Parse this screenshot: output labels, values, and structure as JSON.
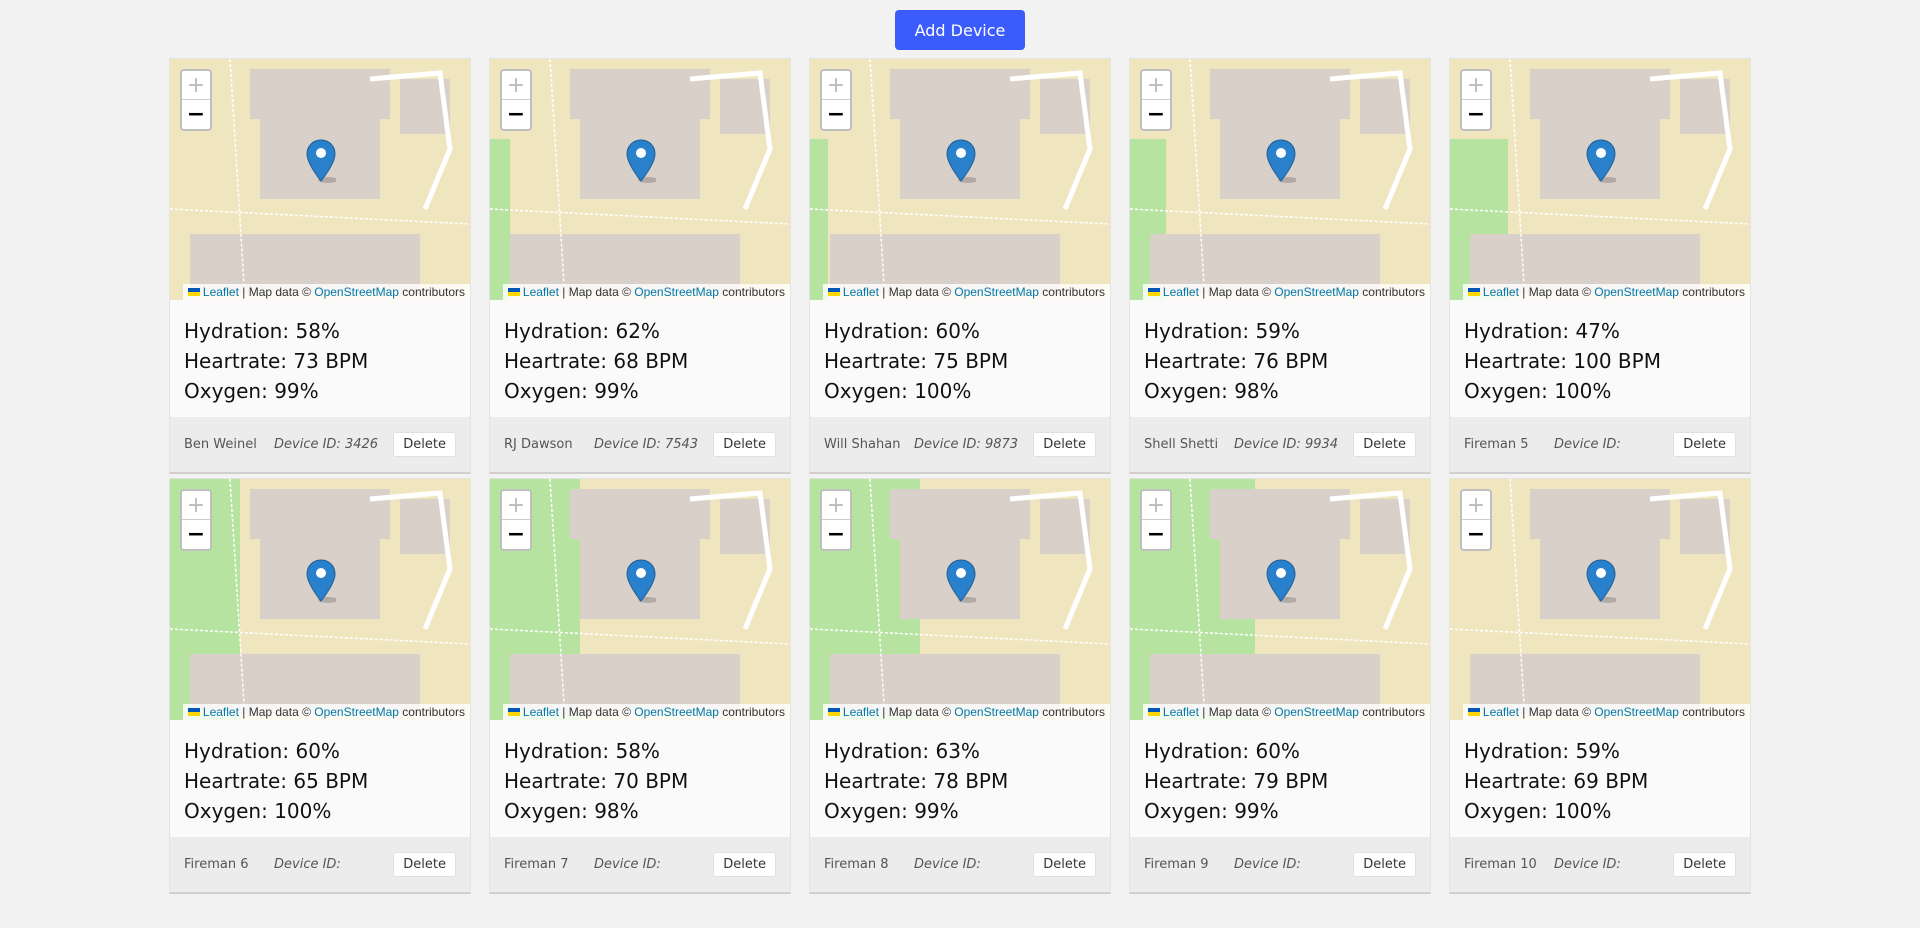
{
  "header": {
    "add_label": "Add Device"
  },
  "map": {
    "zoom_in": "+",
    "zoom_out": "−",
    "attribution": {
      "leaflet": "Leaflet",
      "sep": " | Map data © ",
      "osm": "OpenStreetMap",
      "tail": " contributors"
    }
  },
  "labels": {
    "hydration": "Hydration: ",
    "heartrate": "Heartrate: ",
    "oxygen": "Oxygen: ",
    "device_id": "Device ID: ",
    "delete": "Delete"
  },
  "devices": [
    {
      "owner": "Ben Weinel",
      "device_id": "3426",
      "hydration": "58%",
      "heartrate": "73 BPM",
      "oxygen": "99%"
    },
    {
      "owner": "RJ Dawson",
      "device_id": "7543",
      "hydration": "62%",
      "heartrate": "68 BPM",
      "oxygen": "99%"
    },
    {
      "owner": "Will Shahan",
      "device_id": "9873",
      "hydration": "60%",
      "heartrate": "75 BPM",
      "oxygen": "100%"
    },
    {
      "owner": "Shell Shetti",
      "device_id": "9934",
      "hydration": "59%",
      "heartrate": "76 BPM",
      "oxygen": "98%"
    },
    {
      "owner": "Fireman 5",
      "device_id": "",
      "hydration": "47%",
      "heartrate": "100 BPM",
      "oxygen": "100%"
    },
    {
      "owner": "Fireman 6",
      "device_id": "",
      "hydration": "60%",
      "heartrate": "65 BPM",
      "oxygen": "100%"
    },
    {
      "owner": "Fireman 7",
      "device_id": "",
      "hydration": "58%",
      "heartrate": "70 BPM",
      "oxygen": "98%"
    },
    {
      "owner": "Fireman 8",
      "device_id": "",
      "hydration": "63%",
      "heartrate": "78 BPM",
      "oxygen": "99%"
    },
    {
      "owner": "Fireman 9",
      "device_id": "",
      "hydration": "60%",
      "heartrate": "79 BPM",
      "oxygen": "99%"
    },
    {
      "owner": "Fireman 10",
      "device_id": "",
      "hydration": "59%",
      "heartrate": "69 BPM",
      "oxygen": "100%"
    }
  ],
  "colors": {
    "accent": "#3b5bfd",
    "marker": "#2a81cb",
    "land": "#efe6c0",
    "park": "#b7e3a0",
    "building": "#d9d0c9"
  }
}
